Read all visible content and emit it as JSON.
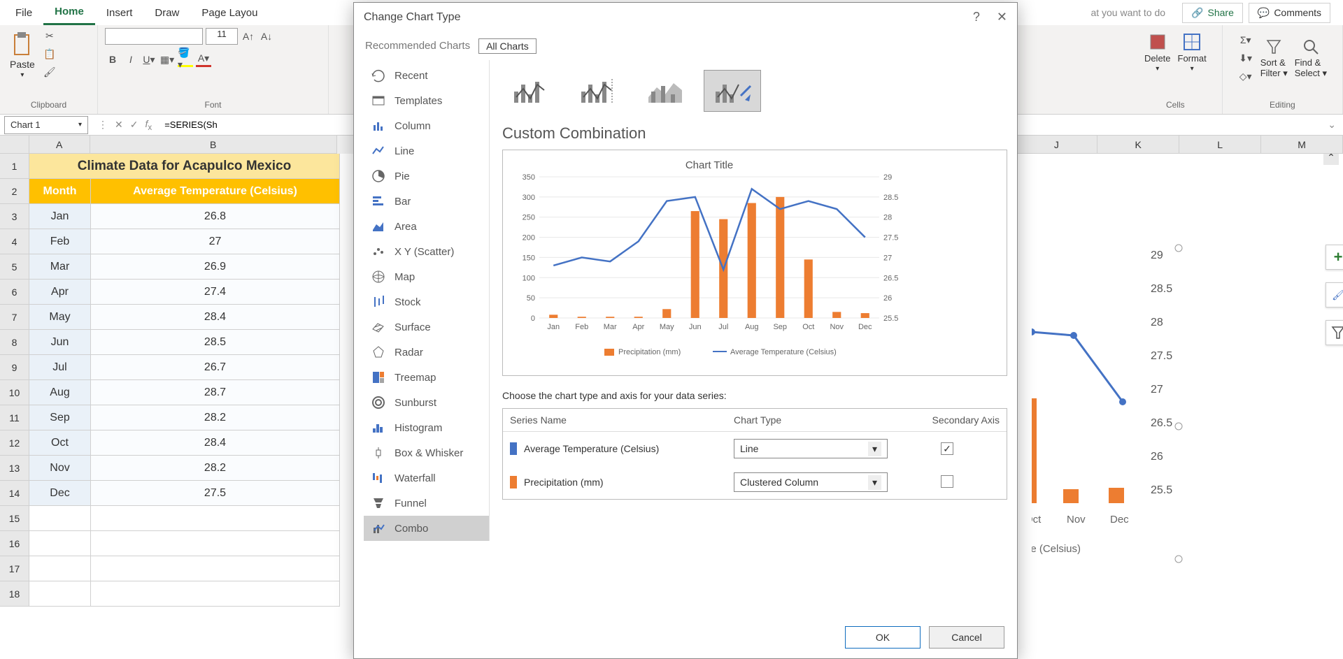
{
  "ribbon": {
    "tabs": [
      "File",
      "Home",
      "Insert",
      "Draw",
      "Page Layou"
    ],
    "active_tab": "Home",
    "tell_me": "at you want to do",
    "share": "Share",
    "comments": "Comments"
  },
  "groups": {
    "clipboard": {
      "paste": "Paste",
      "label": "Clipboard"
    },
    "font": {
      "label": "Font",
      "size": "11"
    },
    "cells": {
      "delete": "Delete",
      "format": "Format",
      "label": "Cells"
    },
    "editing": {
      "sort": "Sort &",
      "filter": "Filter",
      "find": "Find &",
      "select": "Select",
      "label": "Editing"
    }
  },
  "formula_bar": {
    "name": "Chart 1",
    "formula": "=SERIES(Sh"
  },
  "columns": [
    "A",
    "B",
    "J",
    "K",
    "L",
    "M"
  ],
  "col_widths": {
    "A": 88,
    "B": 356
  },
  "spreadsheet": {
    "title": "Climate Data for Acapulco Mexico",
    "hdr_a": "Month",
    "hdr_b": "Average Temperature (Celsius)",
    "rows": [
      {
        "m": "Jan",
        "t": "26.8"
      },
      {
        "m": "Feb",
        "t": "27"
      },
      {
        "m": "Mar",
        "t": "26.9"
      },
      {
        "m": "Apr",
        "t": "27.4"
      },
      {
        "m": "May",
        "t": "28.4"
      },
      {
        "m": "Jun",
        "t": "28.5"
      },
      {
        "m": "Jul",
        "t": "26.7"
      },
      {
        "m": "Aug",
        "t": "28.7"
      },
      {
        "m": "Sep",
        "t": "28.2"
      },
      {
        "m": "Oct",
        "t": "28.4"
      },
      {
        "m": "Nov",
        "t": "28.2"
      },
      {
        "m": "Dec",
        "t": "27.5"
      }
    ]
  },
  "dialog": {
    "title": "Change Chart Type",
    "tab_rec": "Recommended Charts",
    "tab_all": "All Charts",
    "chart_types": [
      "Recent",
      "Templates",
      "Column",
      "Line",
      "Pie",
      "Bar",
      "Area",
      "X Y (Scatter)",
      "Map",
      "Stock",
      "Surface",
      "Radar",
      "Treemap",
      "Sunburst",
      "Histogram",
      "Box & Whisker",
      "Waterfall",
      "Funnel",
      "Combo"
    ],
    "selected_type": "Combo",
    "section_title": "Custom Combination",
    "series_prompt": "Choose the chart type and axis for your data series:",
    "hdr_series": "Series Name",
    "hdr_type": "Chart Type",
    "hdr_axis": "Secondary Axis",
    "series": [
      {
        "name": "Average Temperature (Celsius)",
        "type": "Line",
        "secondary": true,
        "color": "#4472c4"
      },
      {
        "name": "Precipitation (mm)",
        "type": "Clustered Column",
        "secondary": false,
        "color": "#ed7d31"
      }
    ],
    "ok": "OK",
    "cancel": "Cancel"
  },
  "chart_data": {
    "type": "combo",
    "title": "Chart Title",
    "categories": [
      "Jan",
      "Feb",
      "Mar",
      "Apr",
      "May",
      "Jun",
      "Jul",
      "Aug",
      "Sep",
      "Oct",
      "Nov",
      "Dec"
    ],
    "series": [
      {
        "name": "Precipitation (mm)",
        "type": "bar",
        "axis": "primary",
        "color": "#ed7d31",
        "values": [
          8,
          3,
          3,
          3,
          22,
          265,
          245,
          285,
          300,
          145,
          15,
          12
        ]
      },
      {
        "name": "Average Temperature (Celsius)",
        "type": "line",
        "axis": "secondary",
        "color": "#4472c4",
        "values": [
          26.8,
          27,
          26.9,
          27.4,
          28.4,
          28.5,
          26.7,
          28.7,
          28.2,
          28.4,
          28.2,
          27.5
        ]
      }
    ],
    "y1": {
      "min": 0,
      "max": 350,
      "step": 50
    },
    "y2": {
      "min": 25.5,
      "max": 29,
      "step": 0.5
    },
    "legend": [
      "Precipitation (mm)",
      "Average Temperature (Celsius)"
    ]
  },
  "bg_chart": {
    "y2_ticks": [
      "29",
      "28.5",
      "28",
      "27.5",
      "27",
      "26.5",
      "26",
      "25.5"
    ],
    "x_ticks": [
      "Oct",
      "Nov",
      "Dec"
    ],
    "legend_frag": "ire (Celsius)"
  }
}
